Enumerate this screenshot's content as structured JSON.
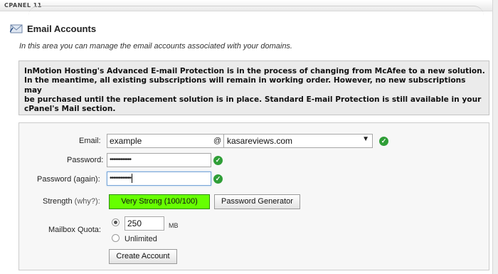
{
  "brand": "CPANEL 11",
  "page": {
    "title": "Email Accounts",
    "subtitle": "In this area you can manage the email accounts associated with your domains."
  },
  "notice": {
    "line1": "InMotion Hosting's Advanced E-mail Protection is in the process of changing from McAfee to a new solution.",
    "line2": "In the meantime, all existing subscriptions will remain in working order. However, no new subscriptions may",
    "line3": "be purchased until the replacement solution is in place. Standard E-mail Protection is still available in your",
    "line4": "cPanel's Mail section."
  },
  "form": {
    "email_label": "Email:",
    "email_value": "example",
    "at": "@",
    "domain_value": "kasareviews.com",
    "password_label": "Password:",
    "password_value": "••••••••••••",
    "password_again_label": "Password (again):",
    "password_again_value": "••••••••••••",
    "strength_label": "Strength",
    "why_link": "(why?):",
    "strength_value": "Very Strong (100/100)",
    "strength_score": 100,
    "password_generator": "Password Generator",
    "quota_label": "Mailbox Quota:",
    "quota_value": "250",
    "quota_unit": "MB",
    "unlimited_label": "Unlimited",
    "create_button": "Create Account"
  },
  "colors": {
    "strength": "#66ff00",
    "valid_check": "#2f9e37"
  },
  "icons": {
    "title": "mail-icon",
    "valid": "checkmark-icon",
    "dropdown": "chevron-down-icon"
  }
}
